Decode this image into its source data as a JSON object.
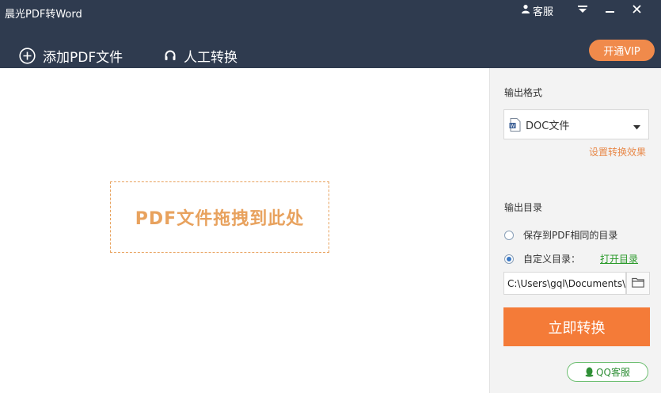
{
  "window": {
    "title": "晨光PDF转Word",
    "support_label": "客服"
  },
  "toolbar": {
    "add_pdf_label": "添加PDF文件",
    "manual_convert_label": "人工转换",
    "vip_label": "开通VIP"
  },
  "dropzone": {
    "text": "PDF文件拖拽到此处"
  },
  "sidebar": {
    "format_label": "输出格式",
    "format_selected": "DOC文件",
    "effect_link": "设置转换效果",
    "dir_label": "输出目录",
    "option_same_dir": "保存到PDF相同的目录",
    "option_custom_dir": "自定义目录：",
    "custom_dir_selected": true,
    "open_dir_link": "打开目录",
    "path_value": "C:\\Users\\gql\\Documents\\",
    "convert_button": "立即转换",
    "qq_support": "QQ客服"
  },
  "icons": {
    "user": "user-icon",
    "dropdown_menu": "menu-caret-icon",
    "minimize": "minimize-icon",
    "close": "close-icon",
    "add": "plus-circle-icon",
    "manual": "headset-icon",
    "doc": "doc-file-icon",
    "folder": "folder-icon",
    "qq": "qq-icon"
  },
  "colors": {
    "titlebar_bg": "#2f3b4f",
    "accent_orange": "#f47b38",
    "vip_orange": "#f08a4b",
    "dropzone_orange": "#e8a25e",
    "link_green": "#2a9a2a",
    "radio_blue": "#3a78c4"
  }
}
